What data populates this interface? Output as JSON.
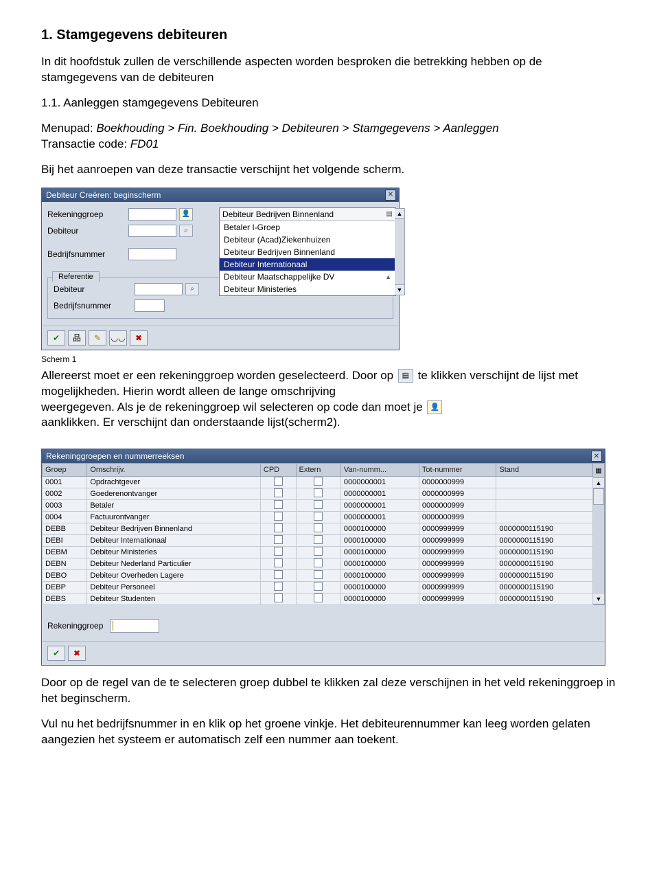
{
  "section": {
    "title": "1. Stamgegevens debiteuren",
    "intro": "In dit hoofdstuk zullen de verschillende aspecten worden besproken die betrekking hebben op de stamgegevens van de debiteuren"
  },
  "subsection": {
    "title": "1.1. Aanleggen stamgegevens Debiteuren",
    "menupad_label": "Menupad: ",
    "menupad_value": "Boekhouding > Fin. Boekhouding > Debiteuren > Stamgegevens > Aanleggen",
    "trans_label": "Transactie code: ",
    "trans_value": "FD01",
    "lead": "Bij het aanroepen van deze transactie verschijnt het volgende scherm."
  },
  "screen1": {
    "title": "Debiteur Creëren: beginscherm",
    "labels": {
      "rekeninggroep": "Rekeninggroep",
      "debiteur": "Debiteur",
      "bedrijfsnummer": "Bedrijfsnummer",
      "referentie": "Referentie"
    },
    "dropdown_header": "Debiteur Bedrijven Binnenland",
    "options": [
      "Betaler I-Groep",
      "Debiteur (Acad)Ziekenhuizen",
      "Debiteur Bedrijven Binnenland",
      "Debiteur Internationaal",
      "Debiteur Maatschappelijke DV",
      "Debiteur Ministeries"
    ],
    "selected_index": 3
  },
  "caption1": "Scherm 1",
  "para2a": "Allereerst moet er een rekeninggroep  worden geselecteerd. Door op",
  "para2b": "te klikken verschijnt de lijst met mogelijkheden. Hierin wordt alleen de lange omschrijving",
  "para2c": "weergegeven. Als je de rekeninggroep wil selecteren op code dan moet je",
  "para2d": "aanklikken. Er verschijnt dan onderstaande lijst(scherm2).",
  "screen2": {
    "title": "Rekeninggroepen en nummerreeksen",
    "headers": [
      "Groep",
      "Omschrijv.",
      "CPD",
      "Extern",
      "Van-numm...",
      "Tot-nummer",
      "Stand"
    ],
    "rows": [
      {
        "grp": "0001",
        "om": "Opdrachtgever",
        "van": "0000000001",
        "tot": "0000000999",
        "st": ""
      },
      {
        "grp": "0002",
        "om": "Goederenontvanger",
        "van": "0000000001",
        "tot": "0000000999",
        "st": ""
      },
      {
        "grp": "0003",
        "om": "Betaler",
        "van": "0000000001",
        "tot": "0000000999",
        "st": ""
      },
      {
        "grp": "0004",
        "om": "Factuurontvanger",
        "van": "0000000001",
        "tot": "0000000999",
        "st": ""
      },
      {
        "grp": "DEBB",
        "om": "Debiteur Bedrijven Binnenland",
        "van": "0000100000",
        "tot": "0000999999",
        "st": "0000000115190"
      },
      {
        "grp": "DEBI",
        "om": "Debiteur Internationaal",
        "van": "0000100000",
        "tot": "0000999999",
        "st": "0000000115190"
      },
      {
        "grp": "DEBM",
        "om": "Debiteur Ministeries",
        "van": "0000100000",
        "tot": "0000999999",
        "st": "0000000115190"
      },
      {
        "grp": "DEBN",
        "om": "Debiteur Nederland Particulier",
        "van": "0000100000",
        "tot": "0000999999",
        "st": "0000000115190"
      },
      {
        "grp": "DEBO",
        "om": "Debiteur Overheden Lagere",
        "van": "0000100000",
        "tot": "0000999999",
        "st": "0000000115190"
      },
      {
        "grp": "DEBP",
        "om": "Debiteur Personeel",
        "van": "0000100000",
        "tot": "0000999999",
        "st": "0000000115190"
      },
      {
        "grp": "DEBS",
        "om": "Debiteur Studenten",
        "van": "0000100000",
        "tot": "0000999999",
        "st": "0000000115190"
      }
    ],
    "bottom_label": "Rekeninggroep"
  },
  "para3": "Door op de regel van de te selecteren groep dubbel te klikken zal deze verschijnen in het veld rekeninggroep in het beginscherm.",
  "para4": "Vul nu het bedrijfsnummer in en  klik op het groene vinkje. Het debiteurennummer kan leeg worden gelaten aangezien het systeem er automatisch zelf een nummer aan toekent."
}
